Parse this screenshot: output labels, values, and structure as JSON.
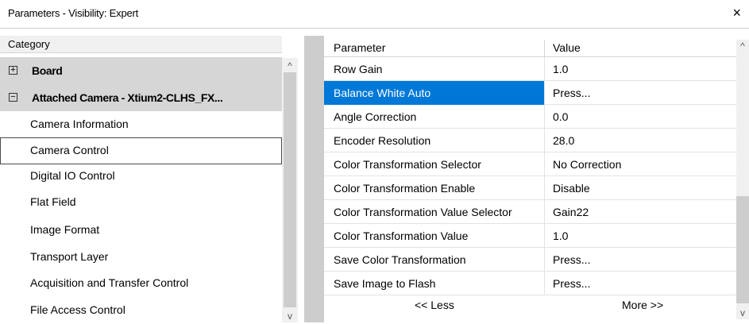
{
  "window": {
    "title": "Parameters - Visibility: Expert",
    "close_glyph": "×"
  },
  "category": {
    "header": "Category",
    "groups": [
      {
        "label": "Board",
        "expander": "+"
      },
      {
        "label": "Attached Camera - Xtium2-CLHS_FX...",
        "expander": "−"
      }
    ],
    "items": [
      "Camera Information",
      "Camera Control",
      "Digital IO Control",
      "Flat Field",
      "Image Format",
      "Transport Layer",
      "Acquisition and Transfer Control",
      "File Access Control"
    ],
    "selected_item": "Camera Control"
  },
  "parameters": {
    "columns": {
      "name": "Parameter",
      "value": "Value"
    },
    "rows": [
      {
        "name": "Row Gain",
        "value": "1.0"
      },
      {
        "name": "Balance White Auto",
        "value": "Press..."
      },
      {
        "name": "Angle Correction",
        "value": "0.0"
      },
      {
        "name": "Encoder Resolution",
        "value": "28.0"
      },
      {
        "name": "Color Transformation Selector",
        "value": "No Correction"
      },
      {
        "name": "Color Transformation Enable",
        "value": "Disable"
      },
      {
        "name": "Color Transformation Value Selector",
        "value": "Gain22"
      },
      {
        "name": "Color Transformation Value",
        "value": "1.0"
      },
      {
        "name": "Save Color Transformation",
        "value": "Press..."
      },
      {
        "name": "Save Image to Flash",
        "value": "Press..."
      }
    ],
    "selected_row": "Balance White Auto",
    "less_label": "<< Less",
    "more_label": "More >>"
  },
  "scroll": {
    "up_glyph": "^",
    "down_glyph": "v"
  },
  "colors": {
    "selection": "#0078d7",
    "group_bg": "#d6d6d6",
    "splitter": "#cdcdcd"
  },
  "icons": {
    "close": "close-icon",
    "expand": "plus-box-icon",
    "collapse": "minus-box-icon",
    "up": "chevron-up-icon",
    "down": "chevron-down-icon"
  }
}
